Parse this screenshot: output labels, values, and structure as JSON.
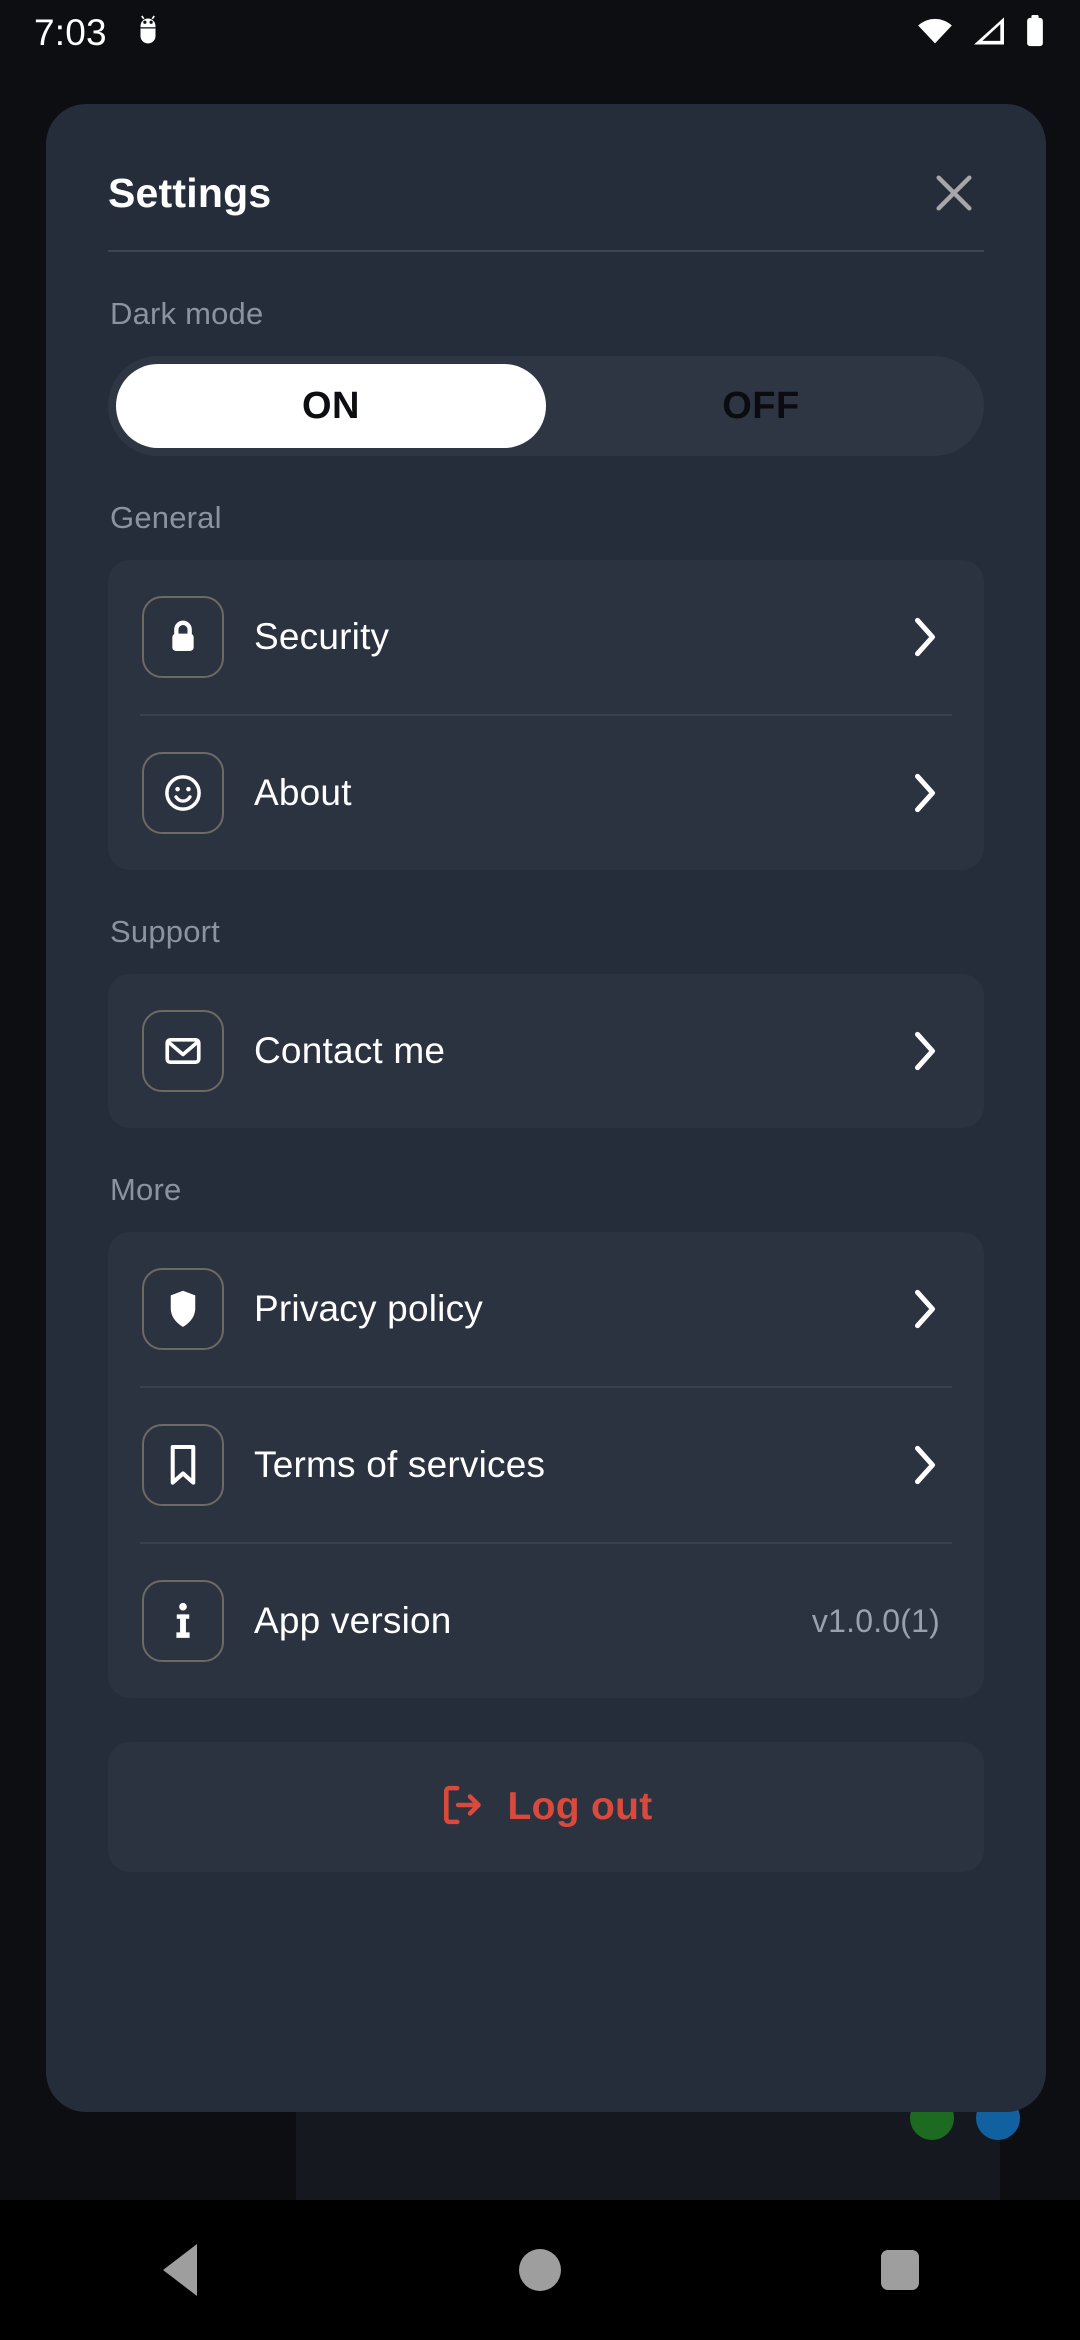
{
  "status_bar": {
    "time": "7:03",
    "icons": [
      "android-debug-icon",
      "wifi-icon",
      "cellular-signal-icon",
      "battery-icon"
    ]
  },
  "sheet": {
    "title": "Settings",
    "close_icon": "close-icon"
  },
  "dark_mode": {
    "label": "Dark mode",
    "options": [
      "ON",
      "OFF"
    ],
    "selected": "ON"
  },
  "sections": [
    {
      "label": "General",
      "rows": [
        {
          "icon": "lock-icon",
          "label": "Security",
          "value": "",
          "chevron": true
        },
        {
          "icon": "smiley-icon",
          "label": "About",
          "value": "",
          "chevron": true
        }
      ]
    },
    {
      "label": "Support",
      "rows": [
        {
          "icon": "envelope-icon",
          "label": "Contact me",
          "value": "",
          "chevron": true
        }
      ]
    },
    {
      "label": "More",
      "rows": [
        {
          "icon": "shield-icon",
          "label": "Privacy policy",
          "value": "",
          "chevron": true
        },
        {
          "icon": "bookmark-icon",
          "label": "Terms of services",
          "value": "",
          "chevron": true
        },
        {
          "icon": "info-icon",
          "label": "App version",
          "value": "v1.0.0(1)",
          "chevron": false
        }
      ]
    }
  ],
  "logout": {
    "label": "Log out",
    "icon": "logout-icon",
    "color": "#d94a3d"
  },
  "nav_bar": {
    "back": "back-button",
    "home": "home-button",
    "recents": "recents-button"
  },
  "colors": {
    "page_background": "#0c0e12",
    "sheet_background": "#252c3a",
    "card_background": "#2b3240",
    "section_label": "#8b93a1",
    "accent_danger": "#d94a3d",
    "toggle_track": "#2e3543",
    "toggle_selected": "#ffffff"
  }
}
